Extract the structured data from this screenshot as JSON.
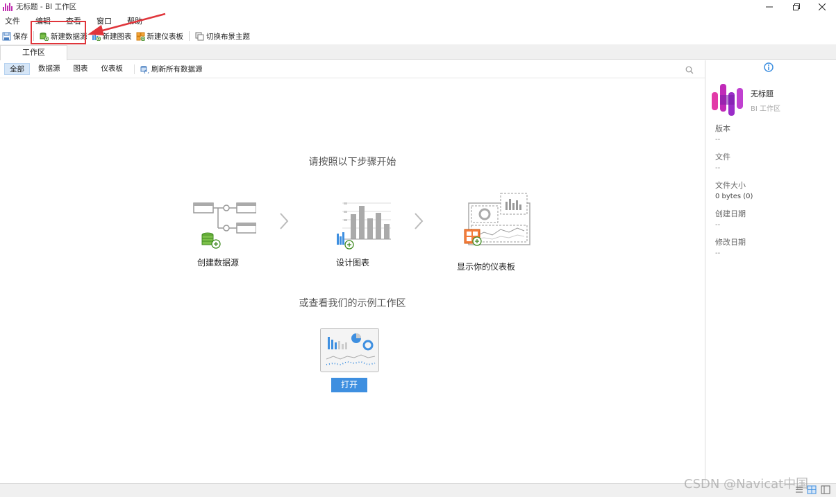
{
  "window": {
    "title": "无标题 - BI 工作区",
    "minimize_glyph": "✕",
    "controls": [
      "minimize",
      "restore",
      "close"
    ]
  },
  "menu": [
    "文件",
    "编辑",
    "查看",
    "窗口",
    "帮助"
  ],
  "toolbar": {
    "save": "保存",
    "new_datasource": "新建数据源",
    "new_chart": "新建图表",
    "new_dashboard": "新建仪表板",
    "switch_theme": "切换布景主题"
  },
  "tabs": [
    {
      "label": "工作区"
    }
  ],
  "filters": {
    "items": [
      "全部",
      "数据源",
      "图表",
      "仪表板"
    ],
    "active": "全部",
    "refresh_all": "刷新所有数据源"
  },
  "main": {
    "heading": "请按照以下步骤开始",
    "steps": [
      {
        "label": "创建数据源",
        "icon": "datasource-icon"
      },
      {
        "label": "设计图表",
        "icon": "chart-icon"
      },
      {
        "label": "显示你的仪表板",
        "icon": "dashboard-icon"
      }
    ],
    "sample_heading": "或查看我们的示例工作区",
    "open_button": "打开"
  },
  "panel": {
    "name": "无标题",
    "type": "BI 工作区",
    "props": [
      {
        "key": "版本",
        "value": "--"
      },
      {
        "key": "文件",
        "value": "--"
      },
      {
        "key": "文件大小",
        "value": "0 bytes (0)"
      },
      {
        "key": "创建日期",
        "value": "--"
      },
      {
        "key": "修改日期",
        "value": "--"
      }
    ]
  },
  "watermark": "CSDN @Navicat中国",
  "colors": {
    "accent": "#3e8fe0",
    "highlight": "#e0353b",
    "brand": "#c030b0"
  }
}
